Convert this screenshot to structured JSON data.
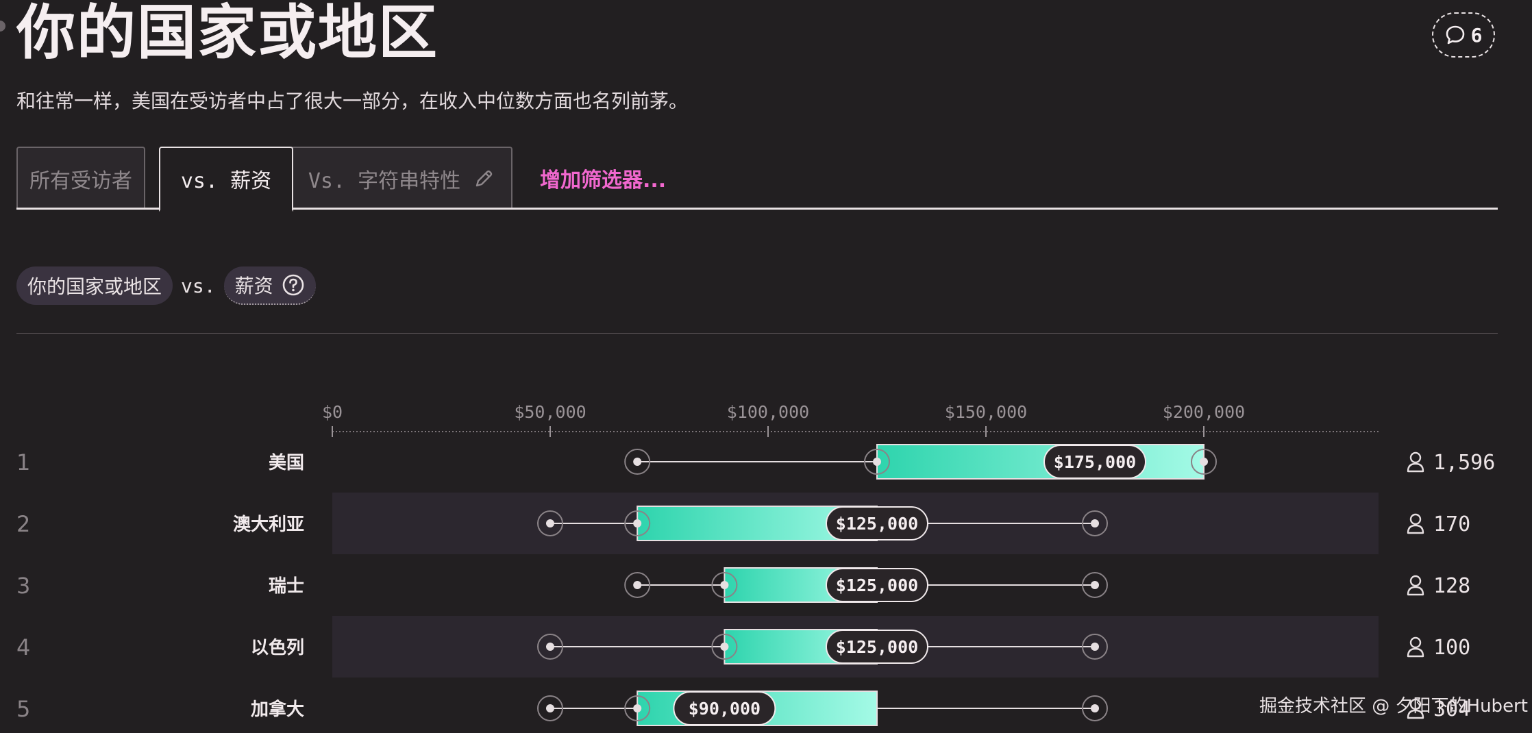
{
  "header": {
    "title": "你的国家或地区",
    "subtitle": "和往常一样，美国在受访者中占了很大一部分，在收入中位数方面也名列前茅。",
    "comment_count": "6"
  },
  "tabs": [
    {
      "label": "所有受访者",
      "active": false
    },
    {
      "label": "vs. 薪资",
      "active": true
    },
    {
      "label": "Vs. 字符串特性",
      "active": false,
      "icon": "pencil-icon"
    }
  ],
  "add_filter_label": "增加筛选器...",
  "chips": {
    "left": "你的国家或地区",
    "vs": "vs.",
    "right": "薪资",
    "right_icon": "question-circle-icon"
  },
  "watermark": "掘金技术社区 @ 夕阳下的Hubert",
  "colors": {
    "background": "#221f21",
    "accent_pink": "#f268cf",
    "bar_start": "#2ed4ad",
    "bar_end": "#a4fae6",
    "row_alt": "#2c272f"
  },
  "chart_data": {
    "type": "box-range",
    "x_unit": "USD",
    "xlim": [
      0,
      240000
    ],
    "x_ticks": [
      0,
      50000,
      100000,
      150000,
      200000
    ],
    "x_tick_labels": [
      "$0",
      "$50,000",
      "$100,000",
      "$150,000",
      "$200,000"
    ],
    "rows": [
      {
        "rank": "1",
        "category": "美国",
        "low": 70000,
        "q1": 125000,
        "median": 175000,
        "q3": 200000,
        "high": 200000,
        "median_label": "$175,000",
        "count_label": "1,596"
      },
      {
        "rank": "2",
        "category": "澳大利亚",
        "low": 50000,
        "q1": 70000,
        "median": 125000,
        "q3": 125000,
        "high": 175000,
        "median_label": "$125,000",
        "count_label": "170"
      },
      {
        "rank": "3",
        "category": "瑞士",
        "low": 70000,
        "q1": 90000,
        "median": 125000,
        "q3": 125000,
        "high": 175000,
        "median_label": "$125,000",
        "count_label": "128"
      },
      {
        "rank": "4",
        "category": "以色列",
        "low": 50000,
        "q1": 90000,
        "median": 125000,
        "q3": 125000,
        "high": 175000,
        "median_label": "$125,000",
        "count_label": "100"
      },
      {
        "rank": "5",
        "category": "加拿大",
        "low": 50000,
        "q1": 70000,
        "median": 90000,
        "q3": 125000,
        "high": 175000,
        "median_label": "$90,000",
        "count_label": "304"
      }
    ]
  }
}
